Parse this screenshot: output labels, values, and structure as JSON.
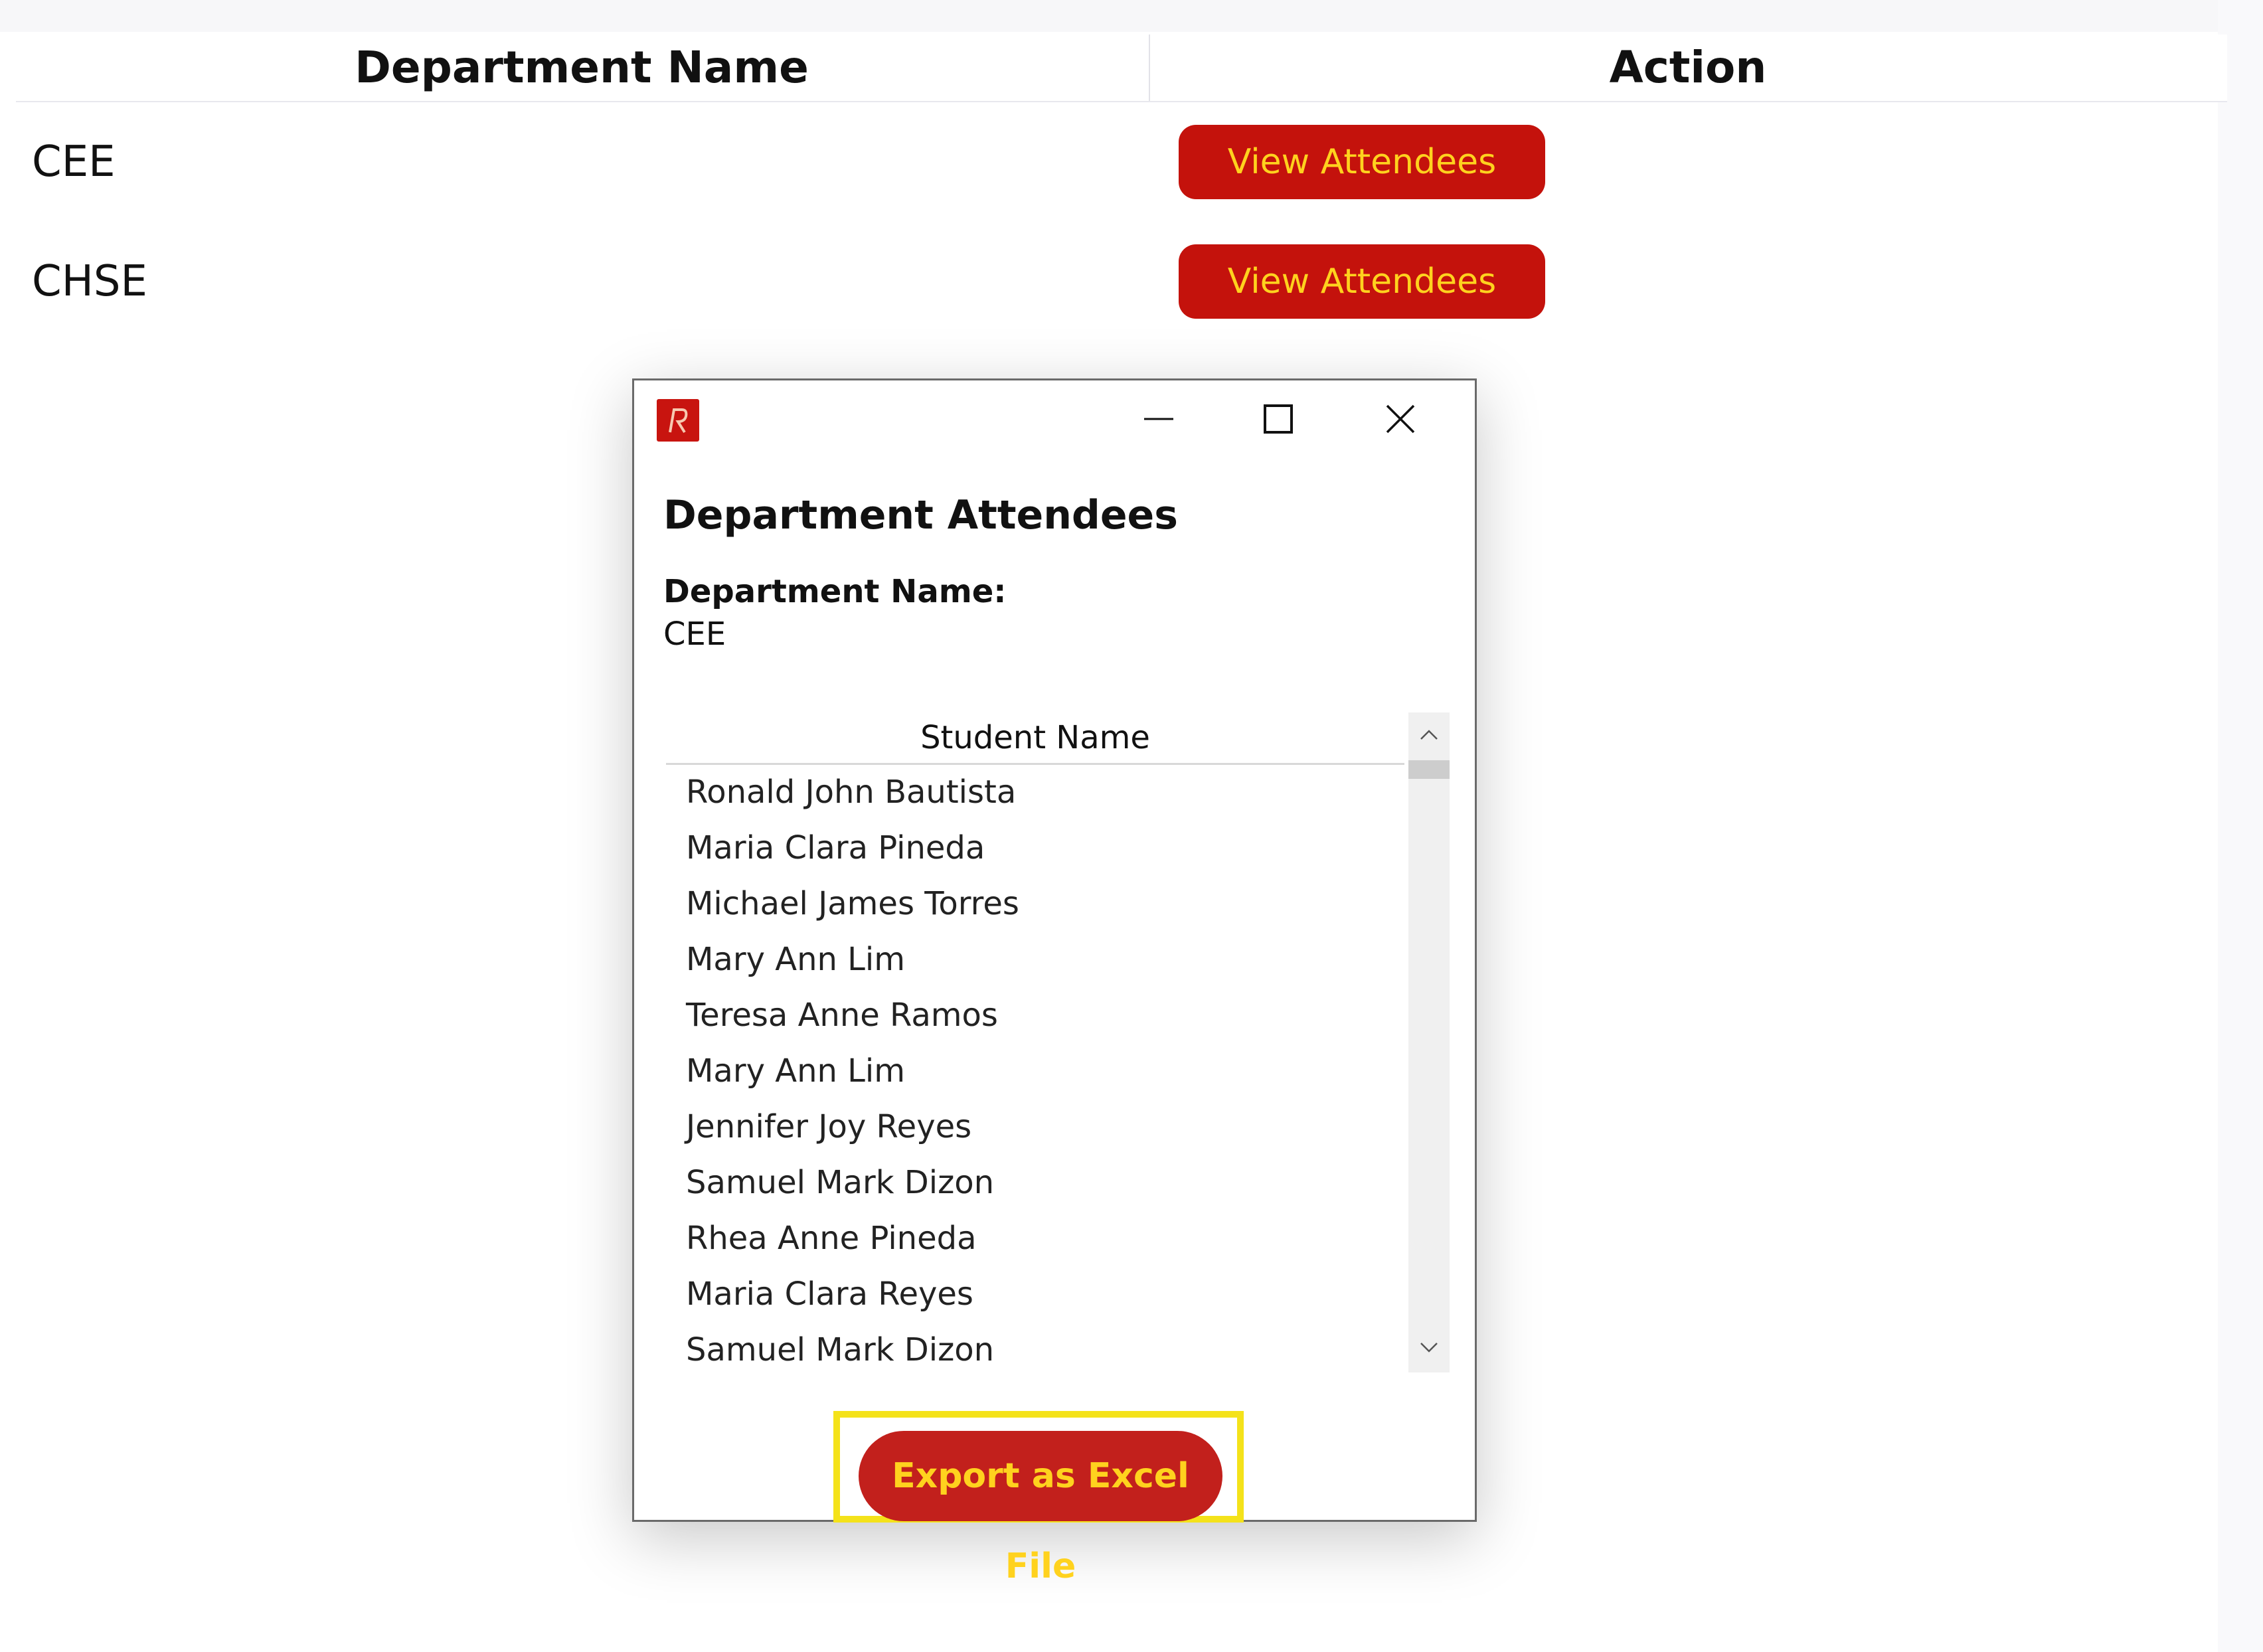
{
  "table": {
    "headers": {
      "department_name": "Department Name",
      "action": "Action"
    },
    "rows": [
      {
        "department": "CEE",
        "action_label": "View Attendees"
      },
      {
        "department": "CHSE",
        "action_label": "View Attendees"
      }
    ]
  },
  "dialog": {
    "title": "Department Attendees",
    "department_label": "Department Name:",
    "department_value": "CEE",
    "list_header": "Student Name",
    "students": [
      "Ronald John Bautista",
      "Maria Clara Pineda",
      "Michael James Torres",
      "Mary Ann Lim",
      "Teresa Anne Ramos",
      "Mary Ann Lim",
      "Jennifer Joy Reyes",
      "Samuel Mark Dizon",
      "Rhea Anne Pineda",
      "Maria Clara Reyes",
      "Samuel Mark Dizon"
    ],
    "export_label": "Export as Excel File",
    "window_controls": [
      "minimize-icon",
      "maximize-icon",
      "close-icon"
    ],
    "app_icon": "app-logo-icon"
  },
  "colors": {
    "button_bg": "#c4120c",
    "button_text": "#ffd21e",
    "export_bg": "#c2201c",
    "highlight": "#f4e21a"
  }
}
